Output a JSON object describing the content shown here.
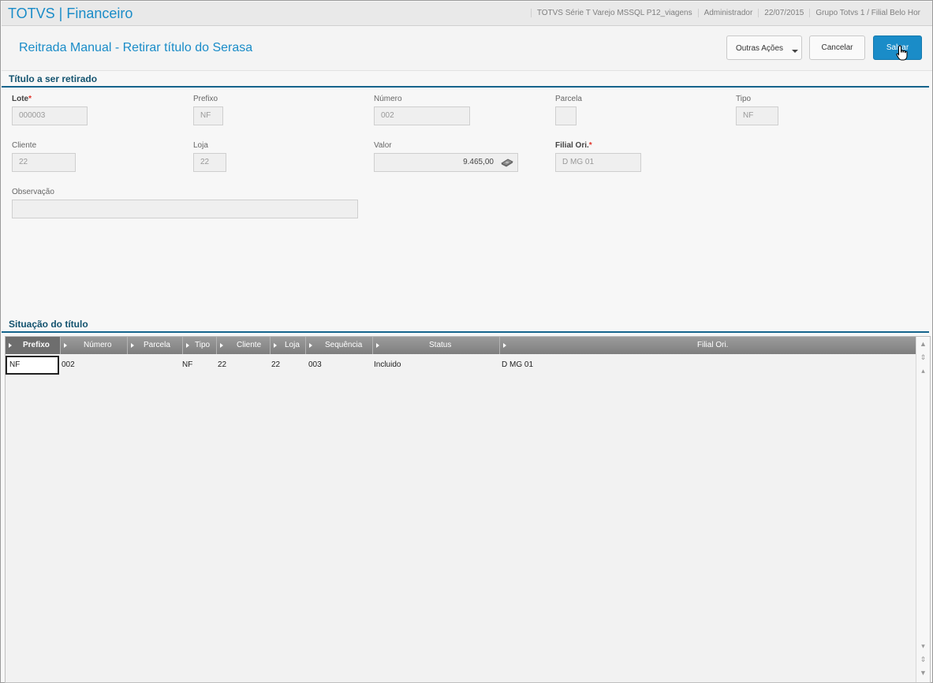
{
  "app": {
    "title": "TOTVS | Financeiro"
  },
  "status_bar": {
    "environment": "TOTVS Série T Varejo MSSQL P12_viagens",
    "user": "Administrador",
    "date": "22/07/2015",
    "branch": "Grupo Totvs 1 / Filial Belo Hor"
  },
  "header": {
    "title": "Reitrada Manual - Retirar título do Serasa",
    "other_actions_label": "Outras Ações",
    "cancel_label": "Cancelar",
    "save_label": "Salvar"
  },
  "form": {
    "section_title": "Título a ser retirado",
    "lote": {
      "label": "Lote",
      "value": "000003"
    },
    "prefixo": {
      "label": "Prefixo",
      "value": "NF"
    },
    "numero": {
      "label": "Número",
      "value": "002"
    },
    "parcela": {
      "label": "Parcela",
      "value": ""
    },
    "tipo": {
      "label": "Tipo",
      "value": "NF"
    },
    "cliente": {
      "label": "Cliente",
      "value": "22"
    },
    "loja": {
      "label": "Loja",
      "value": "22"
    },
    "valor": {
      "label": "Valor",
      "value": "9.465,00"
    },
    "filial_ori": {
      "label": "Filial Ori.",
      "value": "D MG 01"
    },
    "observacao": {
      "label": "Observação",
      "value": ""
    }
  },
  "grid": {
    "section_title": "Situação do título",
    "columns": [
      "Prefixo",
      "Número",
      "Parcela",
      "Tipo",
      "Cliente",
      "Loja",
      "Sequência",
      "Status",
      "Filial Ori."
    ],
    "rows": [
      {
        "prefixo": "NF",
        "numero": "002",
        "parcela": "",
        "tipo": "NF",
        "cliente": "22",
        "loja": "22",
        "sequencia": "003",
        "status": "Incluido",
        "filial_ori": "D MG 01"
      }
    ]
  },
  "required_mark": "*",
  "colors": {
    "accent": "#1a8cc8",
    "section": "#13536f",
    "required": "#e0342a"
  }
}
